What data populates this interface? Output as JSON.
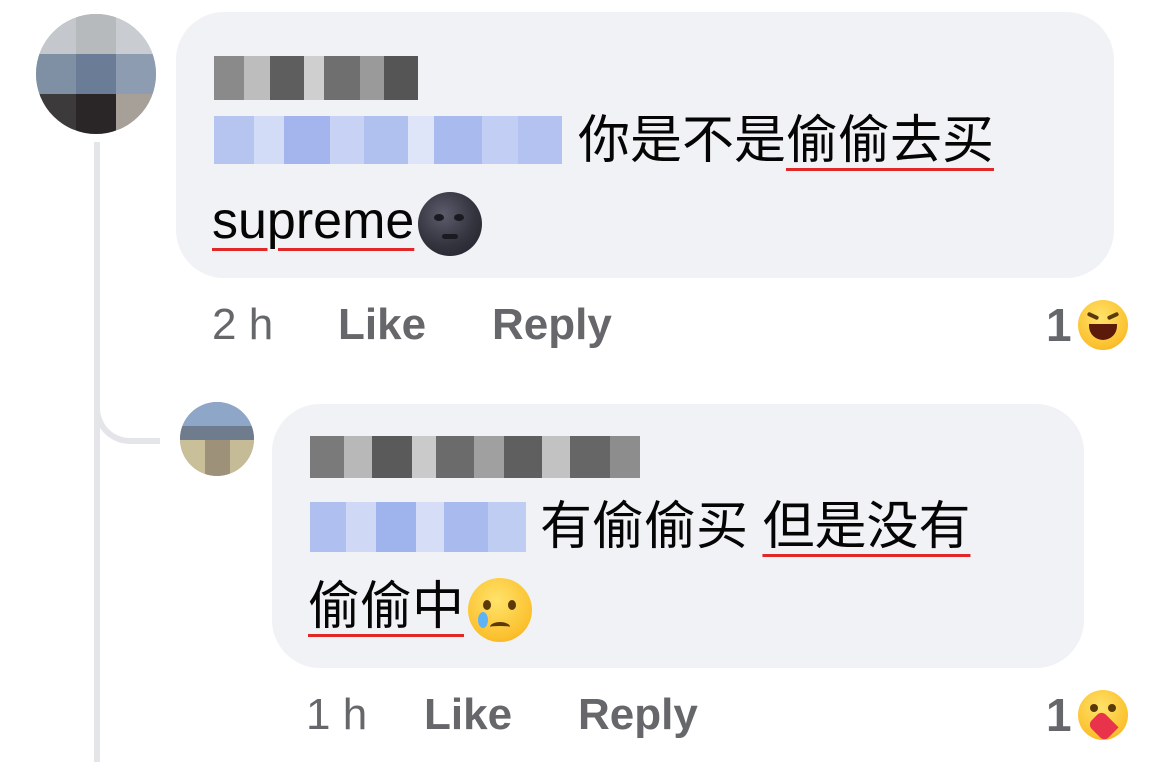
{
  "comments": [
    {
      "author_name": "Ryan Lei",
      "mention": "Chee-Hao Tan",
      "text_line1": "你是不是",
      "text_line1_underlined": "偷偷去买",
      "text_line2_underlined": "supreme",
      "emoji": "new-moon-face",
      "time": "2 h",
      "like_label": "Like",
      "reply_label": "Reply",
      "reaction_count": "1",
      "reaction_emoji": "haha"
    },
    {
      "author_name": "Chee-Hao Tan",
      "mention": "Ryan Lei",
      "text_line1": "有偷偷买 ",
      "text_line1_underlined": "但是没有",
      "text_line2_underlined": "偷偷中",
      "emoji": "crying-face",
      "time": "1 h",
      "like_label": "Like",
      "reply_label": "Reply",
      "reaction_count": "1",
      "reaction_emoji": "care"
    }
  ],
  "colors": {
    "bubble": "#f0f2f5",
    "meta_text": "#65676b",
    "mention_blur": "#aebff0",
    "name_blur": "#6a6a6a",
    "spellcheck_underline": "#e02828"
  }
}
